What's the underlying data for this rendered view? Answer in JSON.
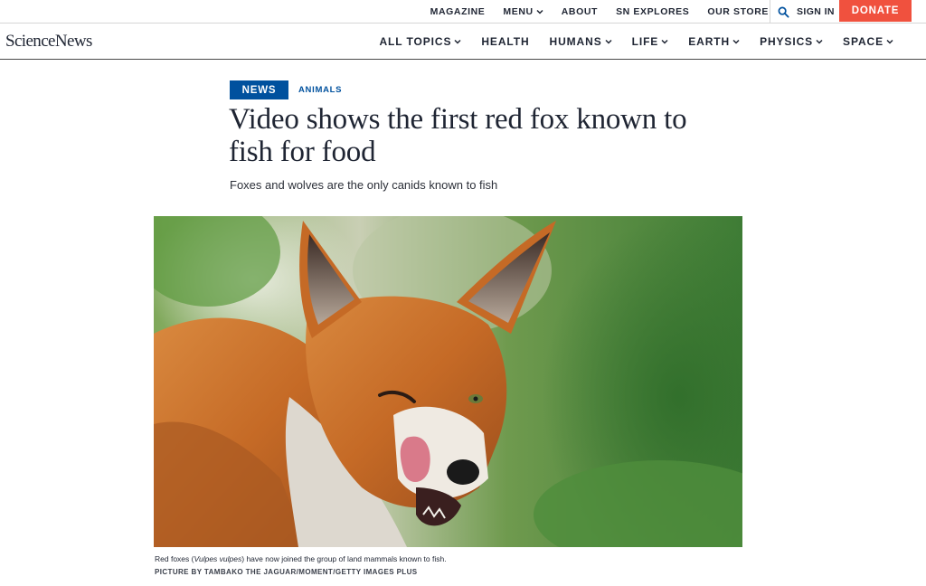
{
  "utility_nav": {
    "items": [
      {
        "label": "MAGAZINE",
        "has_menu": false
      },
      {
        "label": "MENU",
        "has_menu": true
      },
      {
        "label": "ABOUT",
        "has_menu": false
      },
      {
        "label": "SN EXPLORES",
        "has_menu": false
      },
      {
        "label": "OUR STORE",
        "has_menu": false
      }
    ],
    "sign_in": "SIGN IN",
    "donate": "DONATE"
  },
  "logo": "ScienceNews",
  "main_nav": {
    "items": [
      {
        "label": "ALL TOPICS",
        "has_menu": true
      },
      {
        "label": "HEALTH",
        "has_menu": false
      },
      {
        "label": "HUMANS",
        "has_menu": true
      },
      {
        "label": "LIFE",
        "has_menu": true
      },
      {
        "label": "EARTH",
        "has_menu": true
      },
      {
        "label": "PHYSICS",
        "has_menu": true
      },
      {
        "label": "SPACE",
        "has_menu": true
      }
    ]
  },
  "article": {
    "type_tag": "NEWS",
    "topic_tag": "ANIMALS",
    "headline": "Video shows the first red fox known to fish for food",
    "dek": "Foxes and wolves are the only canids known to fish",
    "caption_before": "Red foxes (",
    "caption_species": "Vulpes vulpes",
    "caption_after": ") have now joined the group of land mammals known to fish.",
    "credit": "PICTURE BY TAMBAKO THE JAGUAR/MOMENT/GETTY IMAGES PLUS"
  },
  "colors": {
    "donate": "#f0513e",
    "news_tag": "#00519e",
    "text": "#1f2533"
  }
}
